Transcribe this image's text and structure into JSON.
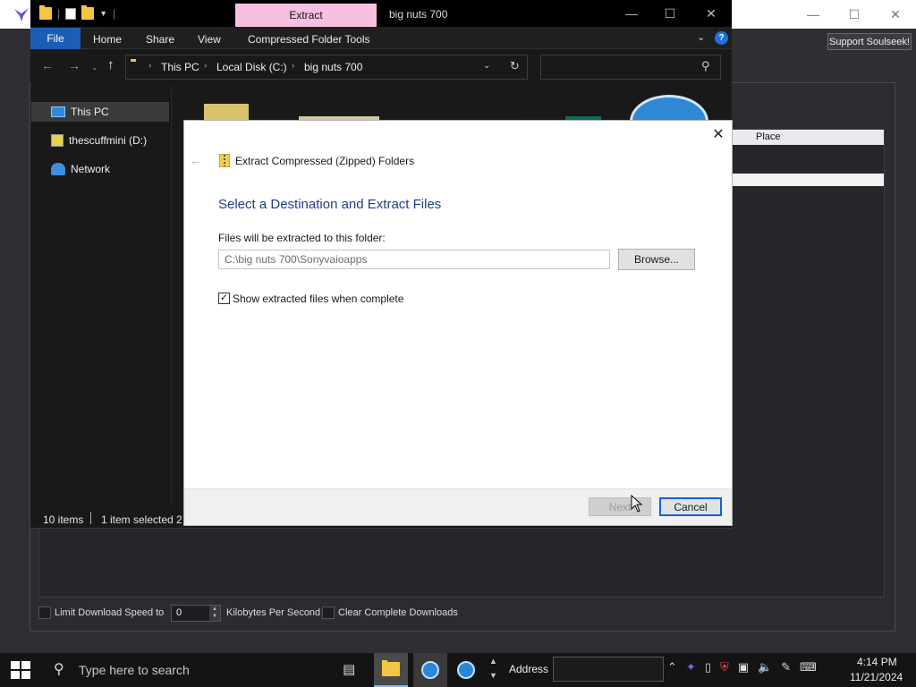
{
  "soulseek": {
    "support_button": "Support Soulseek!",
    "list_header_place": "Place",
    "limit_label": "Limit Download Speed to",
    "speed_value": "0",
    "kbps_label": "Kilobytes Per Second",
    "clear_label": "Clear Complete Downloads"
  },
  "explorer": {
    "context_tab": "Extract",
    "window_title": "big nuts 700",
    "ribbon_tabs": [
      "File",
      "Home",
      "Share",
      "View",
      "Compressed Folder Tools"
    ],
    "breadcrumbs": [
      "This PC",
      "Local Disk (C:)",
      "big nuts 700"
    ],
    "nav_items": [
      "This PC",
      "thescuffmini (D:)",
      "Network"
    ],
    "status_items": "10 items",
    "status_selected": "1 item selected 2"
  },
  "dialog": {
    "title": "Extract Compressed (Zipped) Folders",
    "heading": "Select a Destination and Extract Files",
    "dest_label": "Files will be extracted to this folder:",
    "path_value": "C:\\big nuts 700\\Sonyvaioapps",
    "browse_label": "Browse...",
    "show_files_label": "Show extracted files when complete",
    "show_files_checked": true,
    "next_label": "Next",
    "cancel_label": "Cancel"
  },
  "taskbar": {
    "search_placeholder": "Type here to search",
    "address_label": "Address",
    "time": "4:14 PM",
    "date": "11/21/2024"
  },
  "colors": {
    "context_tab_pink": "#f7bfe0",
    "file_tab_blue": "#1a5fb4",
    "dialog_heading_blue": "#1e3f8a",
    "focus_blue": "#0a64d6"
  },
  "icons": [
    "soulseek-bird-icon",
    "folder-icon",
    "properties-icon",
    "back-arrow-icon",
    "forward-arrow-icon",
    "up-arrow-icon",
    "refresh-icon",
    "search-icon",
    "zip-folder-icon",
    "close-icon",
    "windows-start-icon",
    "task-view-icon"
  ]
}
